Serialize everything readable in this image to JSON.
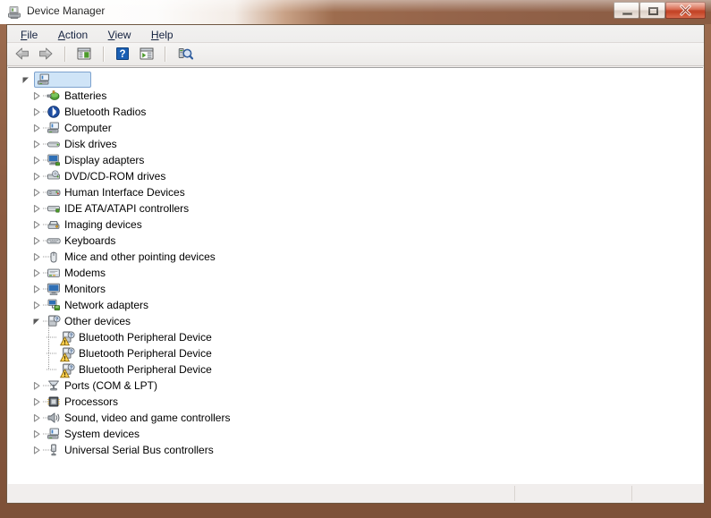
{
  "window": {
    "title": "Device Manager",
    "icon": "device-manager-icon",
    "controls": {
      "minimize": "Minimize",
      "maximize": "Maximize",
      "close": "Close"
    }
  },
  "menubar": {
    "items": [
      {
        "label": "File",
        "accel": "F"
      },
      {
        "label": "Action",
        "accel": "A"
      },
      {
        "label": "View",
        "accel": "V"
      },
      {
        "label": "Help",
        "accel": "H"
      }
    ]
  },
  "toolbar": {
    "buttons": [
      {
        "name": "back-button",
        "icon": "back-arrow-icon"
      },
      {
        "name": "forward-button",
        "icon": "forward-arrow-icon"
      },
      {
        "name": "show-hide-console-tree-button",
        "icon": "console-tree-icon"
      },
      {
        "name": "help-button",
        "icon": "question-mark-icon"
      },
      {
        "name": "properties-button",
        "icon": "properties-icon"
      },
      {
        "name": "scan-hardware-changes-button",
        "icon": "scan-hardware-icon"
      }
    ]
  },
  "tree": {
    "root": {
      "label": "",
      "icon": "computer-icon",
      "expanded": true,
      "selected": true
    },
    "nodes": [
      {
        "label": "Batteries",
        "icon": "battery-icon",
        "expandable": true,
        "expanded": false,
        "level": 1,
        "warning": false
      },
      {
        "label": "Bluetooth Radios",
        "icon": "bluetooth-icon",
        "expandable": true,
        "expanded": false,
        "level": 1,
        "warning": false
      },
      {
        "label": "Computer",
        "icon": "computer-icon",
        "expandable": true,
        "expanded": false,
        "level": 1,
        "warning": false
      },
      {
        "label": "Disk drives",
        "icon": "disk-drive-icon",
        "expandable": true,
        "expanded": false,
        "level": 1,
        "warning": false
      },
      {
        "label": "Display adapters",
        "icon": "display-icon",
        "expandable": true,
        "expanded": false,
        "level": 1,
        "warning": false
      },
      {
        "label": "DVD/CD-ROM drives",
        "icon": "dvd-drive-icon",
        "expandable": true,
        "expanded": false,
        "level": 1,
        "warning": false
      },
      {
        "label": "Human Interface Devices",
        "icon": "hid-icon",
        "expandable": true,
        "expanded": false,
        "level": 1,
        "warning": false
      },
      {
        "label": "IDE ATA/ATAPI controllers",
        "icon": "ide-icon",
        "expandable": true,
        "expanded": false,
        "level": 1,
        "warning": false
      },
      {
        "label": "Imaging devices",
        "icon": "imaging-icon",
        "expandable": true,
        "expanded": false,
        "level": 1,
        "warning": false
      },
      {
        "label": "Keyboards",
        "icon": "keyboard-icon",
        "expandable": true,
        "expanded": false,
        "level": 1,
        "warning": false
      },
      {
        "label": "Mice and other pointing devices",
        "icon": "mouse-icon",
        "expandable": true,
        "expanded": false,
        "level": 1,
        "warning": false
      },
      {
        "label": "Modems",
        "icon": "modem-icon",
        "expandable": true,
        "expanded": false,
        "level": 1,
        "warning": false
      },
      {
        "label": "Monitors",
        "icon": "monitor-icon",
        "expandable": true,
        "expanded": false,
        "level": 1,
        "warning": false
      },
      {
        "label": "Network adapters",
        "icon": "network-icon",
        "expandable": true,
        "expanded": false,
        "level": 1,
        "warning": false
      },
      {
        "label": "Other devices",
        "icon": "unknown-device-icon",
        "expandable": true,
        "expanded": true,
        "level": 1,
        "warning": false
      },
      {
        "label": "Bluetooth Peripheral Device",
        "icon": "unknown-device-icon",
        "expandable": false,
        "expanded": false,
        "level": 2,
        "warning": true
      },
      {
        "label": "Bluetooth Peripheral Device",
        "icon": "unknown-device-icon",
        "expandable": false,
        "expanded": false,
        "level": 2,
        "warning": true
      },
      {
        "label": "Bluetooth Peripheral Device",
        "icon": "unknown-device-icon",
        "expandable": false,
        "expanded": false,
        "level": 2,
        "warning": true
      },
      {
        "label": "Ports (COM & LPT)",
        "icon": "port-icon",
        "expandable": true,
        "expanded": false,
        "level": 1,
        "warning": false
      },
      {
        "label": "Processors",
        "icon": "processor-icon",
        "expandable": true,
        "expanded": false,
        "level": 1,
        "warning": false
      },
      {
        "label": "Sound, video and game controllers",
        "icon": "sound-icon",
        "expandable": true,
        "expanded": false,
        "level": 1,
        "warning": false
      },
      {
        "label": "System devices",
        "icon": "system-device-icon",
        "expandable": true,
        "expanded": false,
        "level": 1,
        "warning": false
      },
      {
        "label": "Universal Serial Bus controllers",
        "icon": "usb-icon",
        "expandable": true,
        "expanded": false,
        "level": 1,
        "warning": false
      }
    ]
  },
  "statusbar": {
    "cells": [
      "",
      "",
      ""
    ]
  },
  "colors": {
    "frame": "#8a5c42",
    "selection_fill": "#cfe4f7",
    "selection_border": "#7da2ce",
    "warning_yellow": "#ffd24d",
    "close_button": "#c0391c",
    "client_bg": "#f1eeed",
    "tree_bg": "#ffffff"
  }
}
